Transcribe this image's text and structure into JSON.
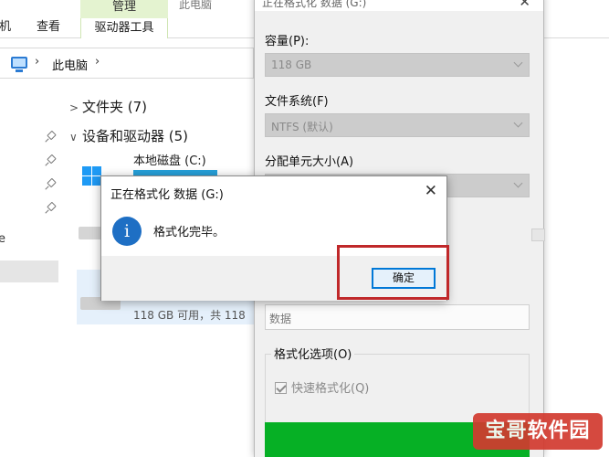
{
  "explorer": {
    "ribbon_tabs": [
      "机",
      "查看"
    ],
    "context_tab_group": "管理",
    "context_tab": "驱动器工具",
    "title_fragment": "此电脑",
    "breadcrumb": "此电脑",
    "groups": [
      {
        "label": "文件夹 (7)",
        "expanded": false
      },
      {
        "label": "设备和驱动器 (5)",
        "expanded": true
      }
    ],
    "drive_c": {
      "name": "本地磁盘 (C:)"
    },
    "drive_g": {
      "free_text": "118 GB 可用，共 118"
    },
    "left_pane_letter": "e"
  },
  "format_panel": {
    "title": "正在格式化 数据 (G:)",
    "capacity_label": "容量(P):",
    "capacity_value": "118 GB",
    "filesystem_label": "文件系统(F)",
    "filesystem_value": "NTFS (默认)",
    "alloc_label": "分配单元大小(A)",
    "volume_label_value": "数据",
    "options_label": "格式化选项(O)",
    "quick_format_label": "快速格式化(Q)",
    "quick_format_checked": true,
    "progress_color": "#06b025"
  },
  "dialog": {
    "title": "正在格式化 数据 (G:)",
    "message": "格式化完毕。",
    "ok_label": "确定",
    "icon": "info-icon"
  },
  "annotation": {
    "highlight_color": "#c0282a"
  },
  "watermark": {
    "text": "宝哥软件园"
  }
}
